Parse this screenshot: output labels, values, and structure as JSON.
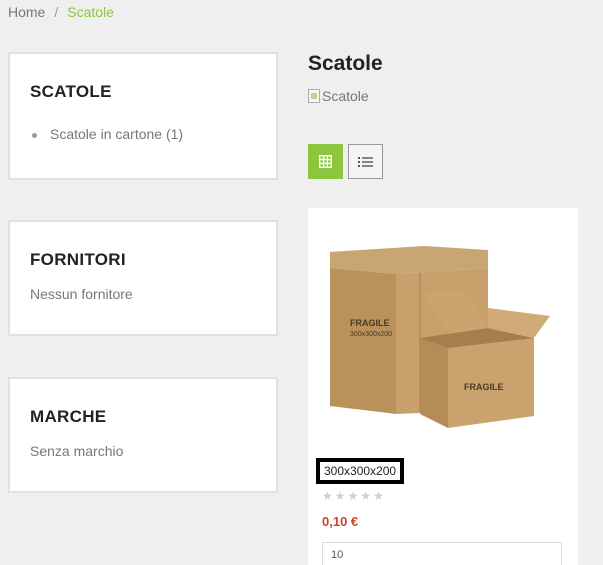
{
  "breadcrumb": {
    "home": "Home",
    "separator": "/",
    "current": "Scatole"
  },
  "sidebar": {
    "categories": {
      "title": "SCATOLE",
      "items": [
        {
          "label": "Scatole in cartone (1)"
        }
      ]
    },
    "suppliers": {
      "title": "FORNITORI",
      "text": "Nessun fornitore"
    },
    "brands": {
      "title": "MARCHE",
      "text": "Senza marchio"
    }
  },
  "main": {
    "title": "Scatole",
    "category_image_alt": "Scatole",
    "view_modes": [
      "grid-icon",
      "list-icon"
    ],
    "product": {
      "name": "300x300x200",
      "box_print_fragile": "FRAGILE",
      "box_print_size": "300x300x200",
      "rating": 0,
      "rating_max": 5,
      "price": "0,10 €",
      "quantity": "10"
    }
  },
  "colors": {
    "accent": "#8cc63f",
    "price": "#c8452b",
    "background": "#efefef"
  }
}
